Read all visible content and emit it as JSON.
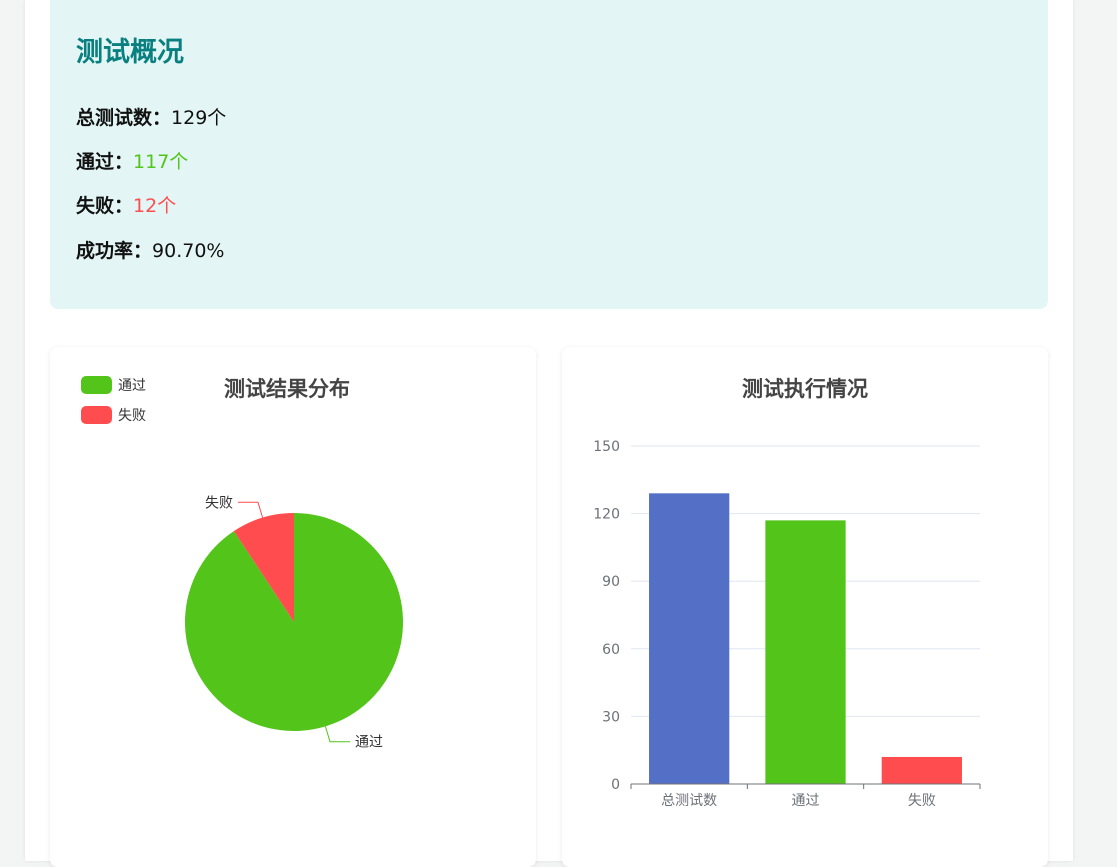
{
  "summary": {
    "title": "测试概况",
    "total_label": "总测试数：",
    "total_value": "129个",
    "pass_label": "通过：",
    "pass_value": "117个",
    "fail_label": "失败：",
    "fail_value": "12个",
    "rate_label": "成功率：",
    "rate_value": "90.70%"
  },
  "colors": {
    "title": "#0a7f80",
    "pass": "#52c41a",
    "fail": "#ff4d4f",
    "total": "#5470c6",
    "summary_bg": "#e3f6f5"
  },
  "chart_data": [
    {
      "type": "pie",
      "title": "测试结果分布",
      "legend": [
        "通过",
        "失败"
      ],
      "legend_position": "top-left",
      "slices": [
        {
          "name": "通过",
          "value": 117,
          "color": "#52c41a"
        },
        {
          "name": "失败",
          "value": 12,
          "color": "#ff4d4f"
        }
      ]
    },
    {
      "type": "bar",
      "title": "测试执行情况",
      "categories": [
        "总测试数",
        "通过",
        "失败"
      ],
      "values": [
        129,
        117,
        12
      ],
      "colors": [
        "#5470c6",
        "#52c41a",
        "#ff4d4f"
      ],
      "ylim": [
        0,
        150
      ],
      "yticks": [
        0,
        30,
        60,
        90,
        120,
        150
      ],
      "grid": true
    }
  ]
}
